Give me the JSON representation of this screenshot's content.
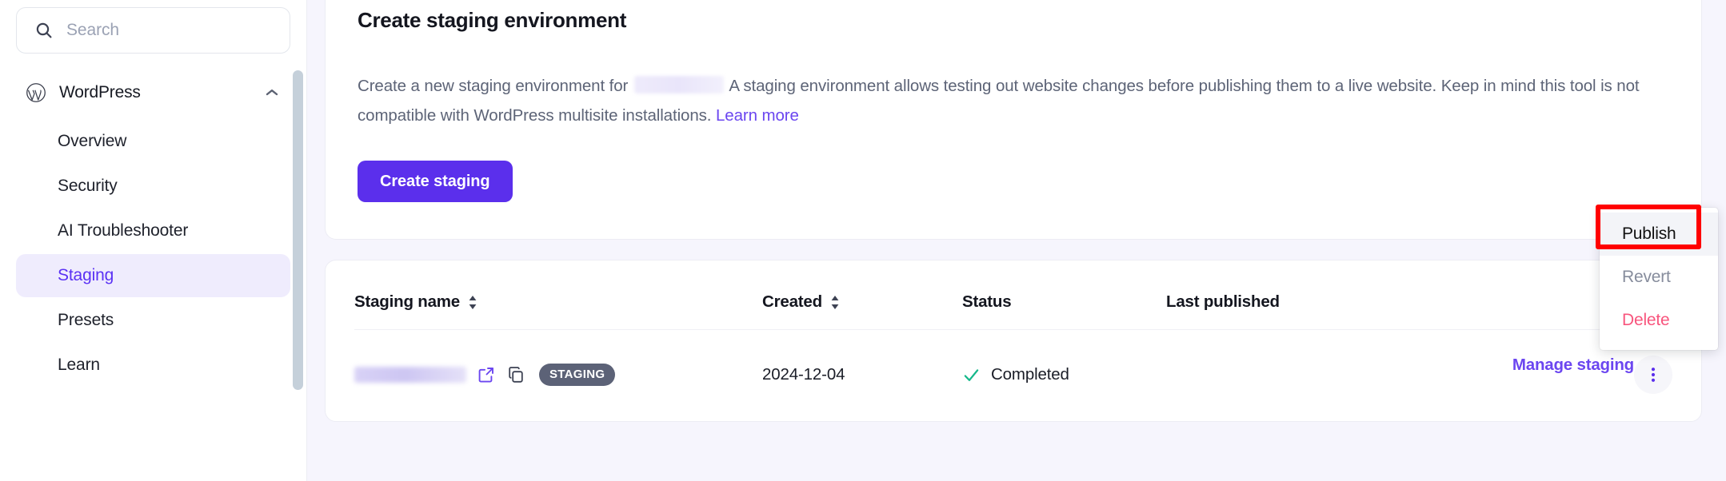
{
  "sidebar": {
    "search": {
      "placeholder": "Search",
      "value": "",
      "icon": "search-icon"
    },
    "section": {
      "label": "WordPress",
      "icon": "wordpress-icon",
      "chevron": "chevron-up-icon"
    },
    "items": [
      {
        "label": "Overview",
        "active": false
      },
      {
        "label": "Security",
        "active": false
      },
      {
        "label": "AI Troubleshooter",
        "active": false
      },
      {
        "label": "Staging",
        "active": true
      },
      {
        "label": "Presets",
        "active": false
      },
      {
        "label": "Learn",
        "active": false
      }
    ]
  },
  "main": {
    "create_card": {
      "title": "Create staging environment",
      "desc_before": "Create a new staging environment for",
      "desc_after": "A staging environment allows testing out website changes before publishing them to a live website. Keep in mind this tool is not compatible with WordPress multisite installations.",
      "learn_more": "Learn more",
      "button": "Create staging"
    },
    "table": {
      "columns": [
        {
          "label": "Staging name",
          "sortable": true
        },
        {
          "label": "Created",
          "sortable": true
        },
        {
          "label": "Status",
          "sortable": false
        },
        {
          "label": "Last published",
          "sortable": false
        }
      ],
      "rows": [
        {
          "name_redacted": true,
          "open_icon": "external-link-icon",
          "copy_icon": "copy-icon",
          "badge": "STAGING",
          "created": "2024-12-04",
          "status": "Completed",
          "status_icon": "check-icon",
          "last_published": "",
          "action_link": "Manage staging",
          "kebab_icon": "more-vertical-icon"
        }
      ]
    }
  },
  "menu": {
    "items": [
      {
        "label": "Publish",
        "state": "highlight"
      },
      {
        "label": "Revert",
        "state": "muted"
      },
      {
        "label": "Delete",
        "state": "danger"
      }
    ]
  },
  "colors": {
    "accent": "#5b2fec",
    "link": "#6b46f0",
    "active_bg": "#efecfd",
    "page_bg": "#f6f5fd",
    "badge_bg": "#5c6277",
    "success": "#14b88a",
    "danger": "#f8557d",
    "highlight_outline": "#ff0000"
  }
}
